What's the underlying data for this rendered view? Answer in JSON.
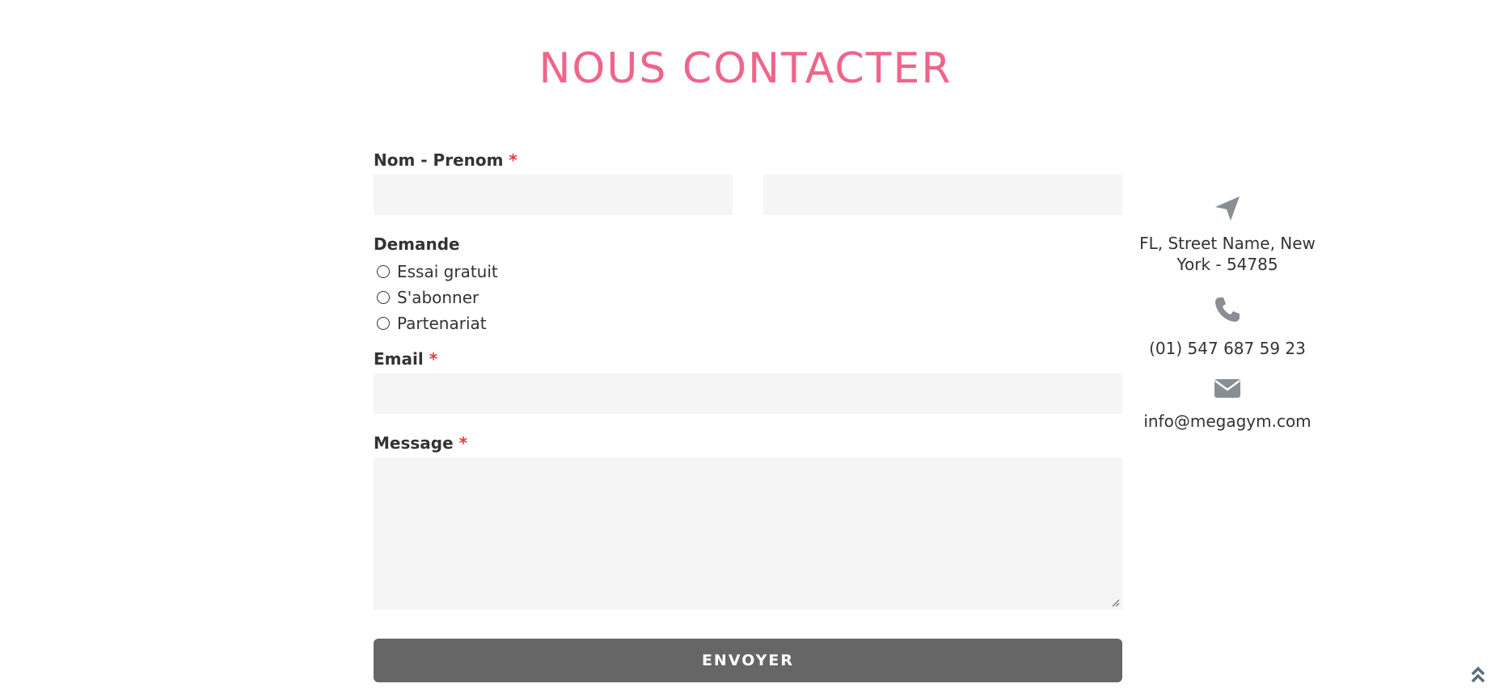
{
  "colors": {
    "accent": "#f0648a",
    "button_bg": "#666666",
    "input_bg": "#f5f5f5",
    "icon": "#888e94",
    "required": "#e8383d"
  },
  "page": {
    "title": "NOUS CONTACTER"
  },
  "form": {
    "name": {
      "label": "Nom - Prenom",
      "required_mark": "*",
      "first_value": "",
      "last_value": ""
    },
    "demande": {
      "label": "Demande",
      "options": [
        "Essai gratuit",
        "S'abonner",
        "Partenariat"
      ]
    },
    "email": {
      "label": "Email",
      "required_mark": "*",
      "value": ""
    },
    "message": {
      "label": "Message",
      "required_mark": "*",
      "value": ""
    },
    "submit_label": "ENVOYER"
  },
  "contact": {
    "address_icon": "location-arrow-icon",
    "address": "FL, Street Name, New York - 54785",
    "phone_icon": "phone-icon",
    "phone": "(01) 547 687 59 23",
    "email_icon": "envelope-icon",
    "email": "info@megagym.com"
  },
  "back_to_top_icon": "double-chevron-up-icon"
}
